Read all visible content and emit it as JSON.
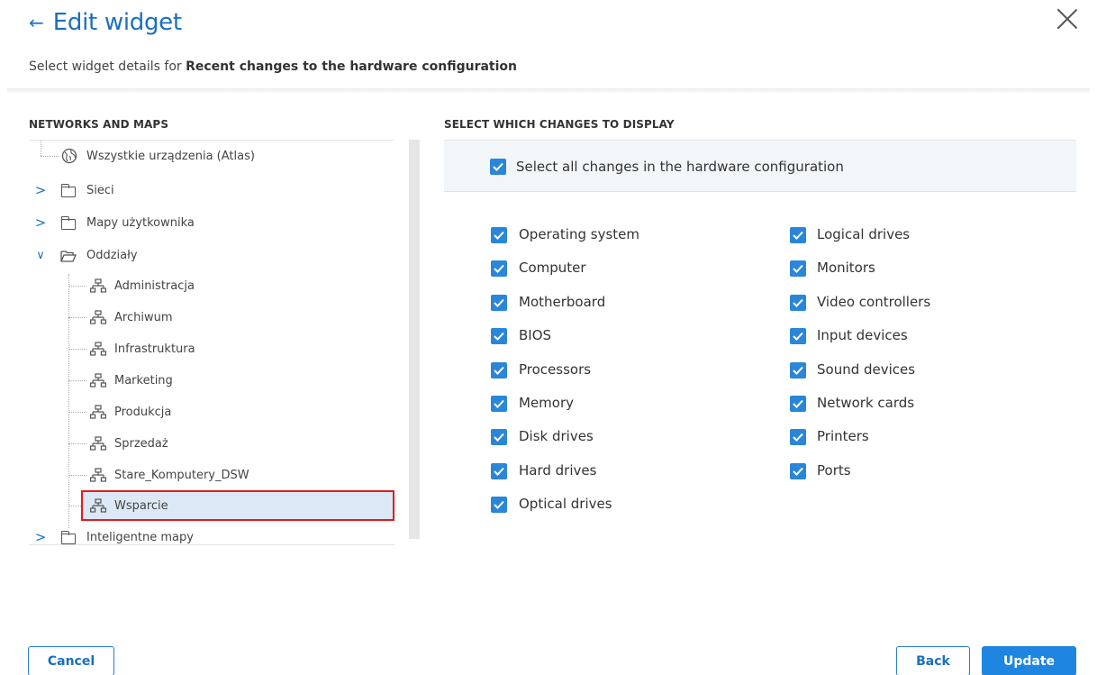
{
  "header": {
    "title": "Edit widget",
    "subtitle_prefix": "Select widget details for ",
    "subtitle_bold": "Recent changes to the hardware configuration"
  },
  "left": {
    "section_label": "NETWORKS AND MAPS",
    "tree": [
      {
        "label": "Wszystkie urządzenia (Atlas)",
        "icon": "globe-icon"
      },
      {
        "label": "Sieci",
        "icon": "folder-icon",
        "chevron": ">"
      },
      {
        "label": "Mapy użytkownika",
        "icon": "folder-icon",
        "chevron": ">"
      },
      {
        "label": "Oddziały",
        "icon": "folder-open-icon",
        "chevron": "∨"
      },
      {
        "label": "Administracja",
        "icon": "network-icon"
      },
      {
        "label": "Archiwum",
        "icon": "network-icon"
      },
      {
        "label": "Infrastruktura",
        "icon": "network-icon"
      },
      {
        "label": "Marketing",
        "icon": "network-icon"
      },
      {
        "label": "Produkcja",
        "icon": "network-icon"
      },
      {
        "label": "Sprzedaż",
        "icon": "network-icon"
      },
      {
        "label": "Stare_Komputery_DSW",
        "icon": "network-icon"
      },
      {
        "label": "Wsparcie",
        "icon": "network-icon",
        "selected": true
      },
      {
        "label": "Inteligentne mapy",
        "icon": "folder-icon",
        "chevron": ">"
      }
    ]
  },
  "right": {
    "section_label": "SELECT WHICH CHANGES TO DISPLAY",
    "select_all_label": "Select all changes in the hardware configuration",
    "col1": [
      "Operating system",
      "Computer",
      "Motherboard",
      "BIOS",
      "Processors",
      "Memory",
      "Disk drives",
      "Hard drives",
      "Optical drives"
    ],
    "col2": [
      "Logical drives",
      "Monitors",
      "Video controllers",
      "Input devices",
      "Sound devices",
      "Network cards",
      "Printers",
      "Ports"
    ]
  },
  "footer": {
    "cancel_label": "Cancel",
    "back_label": "Back",
    "update_label": "Update"
  },
  "colors": {
    "accent": "#1a6fc0",
    "checkbox": "#2a86d8",
    "selection_border": "#e21c1c",
    "selection_fill": "#dce8f5"
  }
}
